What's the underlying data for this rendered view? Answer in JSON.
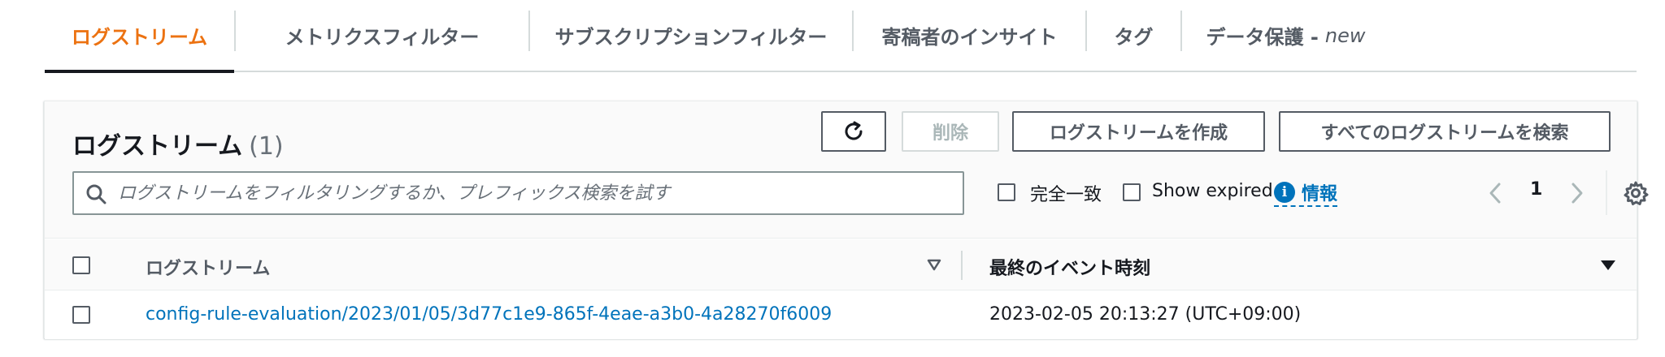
{
  "tabs": [
    {
      "label": "ログストリーム",
      "active": true
    },
    {
      "label": "メトリクスフィルター"
    },
    {
      "label": "サブスクリプションフィルター"
    },
    {
      "label": "寄稿者のインサイト"
    },
    {
      "label": "タグ"
    },
    {
      "label": "データ保護 -",
      "badge": "new"
    }
  ],
  "panel": {
    "title": "ログストリーム",
    "count": "(1)",
    "delete_label": "削除",
    "create_label": "ログストリームを作成",
    "search_all_label": "すべてのログストリームを検索"
  },
  "search": {
    "placeholder": "ログストリームをフィルタリングするか、プレフィックス検索を試す",
    "value": ""
  },
  "filters": {
    "exact_match_label": "完全一致",
    "show_expired_label": "Show expired",
    "info_label": "情報"
  },
  "pagination": {
    "current_page": "1"
  },
  "table": {
    "columns": [
      "ログストリーム",
      "最終のイベント時刻"
    ],
    "rows": [
      {
        "name": "config-rule-evaluation/2023/01/05/3d77c1e9-865f-4eae-a3b0-4a28270f6009",
        "last_event": "2023-02-05 20:13:27 (UTC+09:00)"
      }
    ]
  },
  "colors": {
    "accent": "#ec7211",
    "link": "#0073bb",
    "text": "#16191f",
    "muted": "#545b64"
  },
  "icons": [
    "refresh-icon",
    "search-icon",
    "info-icon",
    "chevron-left-icon",
    "chevron-right-icon",
    "gear-icon",
    "sort-icon",
    "sort-desc-icon"
  ]
}
